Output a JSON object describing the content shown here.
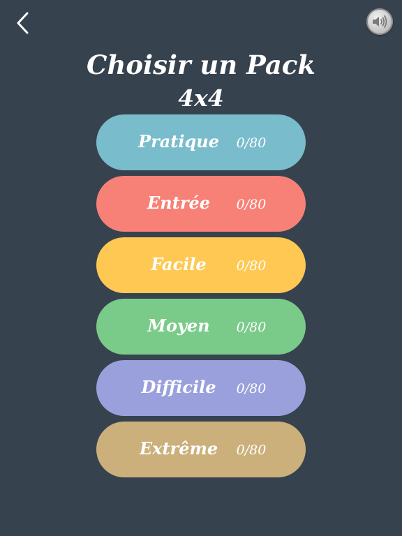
{
  "header": {
    "title": "Choisir un Pack",
    "subtitle": "4x4"
  },
  "icons": {
    "back": "chevron-left-icon",
    "sound": "speaker-icon"
  },
  "packs": [
    {
      "name": "Pratique",
      "progress": "0/80",
      "color": "#79bccb"
    },
    {
      "name": "Entrée",
      "progress": "0/80",
      "color": "#f78176"
    },
    {
      "name": "Facile",
      "progress": "0/80",
      "color": "#fec852"
    },
    {
      "name": "Moyen",
      "progress": "0/80",
      "color": "#7acb89"
    },
    {
      "name": "Difficile",
      "progress": "0/80",
      "color": "#9aa0dc"
    },
    {
      "name": "Extrême",
      "progress": "0/80",
      "color": "#cbb07c"
    }
  ],
  "colors": {
    "background": "#37424f",
    "text": "#ffffff"
  }
}
